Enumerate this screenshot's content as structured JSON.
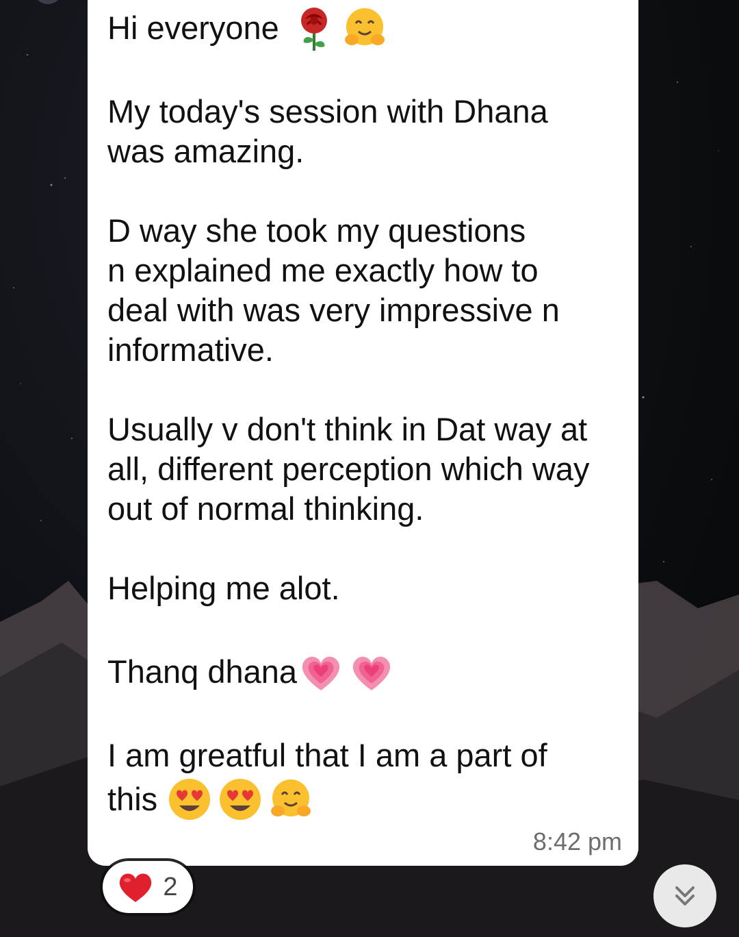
{
  "message": {
    "greeting": "Hi everyone",
    "p1_line1": "My today's session with Dhana",
    "p1_line2": "was amazing.",
    "p2_line1": "D way she took my questions",
    "p2_line2": "n explained me exactly how to",
    "p2_line3": "deal with was very impressive n",
    "p2_line4": "informative.",
    "p3_line1": "Usually v don't think in Dat way at",
    "p3_line2": "all, different perception which way",
    "p3_line3": "out of normal thinking.",
    "p4": "Helping me alot.",
    "p5": "Thanq dhana",
    "p6_line1": "I am greatful that I am a part of",
    "p6_line2": "this",
    "timestamp": "8:42 pm",
    "emojis": {
      "greeting": [
        "rose-icon",
        "hugging-face-icon"
      ],
      "thanks": [
        "growing-heart-icon",
        "growing-heart-icon"
      ],
      "closing": [
        "heart-eyes-face-icon",
        "heart-eyes-face-icon",
        "hugging-face-icon"
      ]
    }
  },
  "reaction": {
    "emoji": "red-heart-icon",
    "count": "2"
  },
  "scroll_button": {
    "icon": "double-chevron-down-icon"
  },
  "colors": {
    "bubble": "#ffffff",
    "text": "#111111",
    "timestamp": "#6d6d6d",
    "scroll_button": "#e9e9e9"
  }
}
